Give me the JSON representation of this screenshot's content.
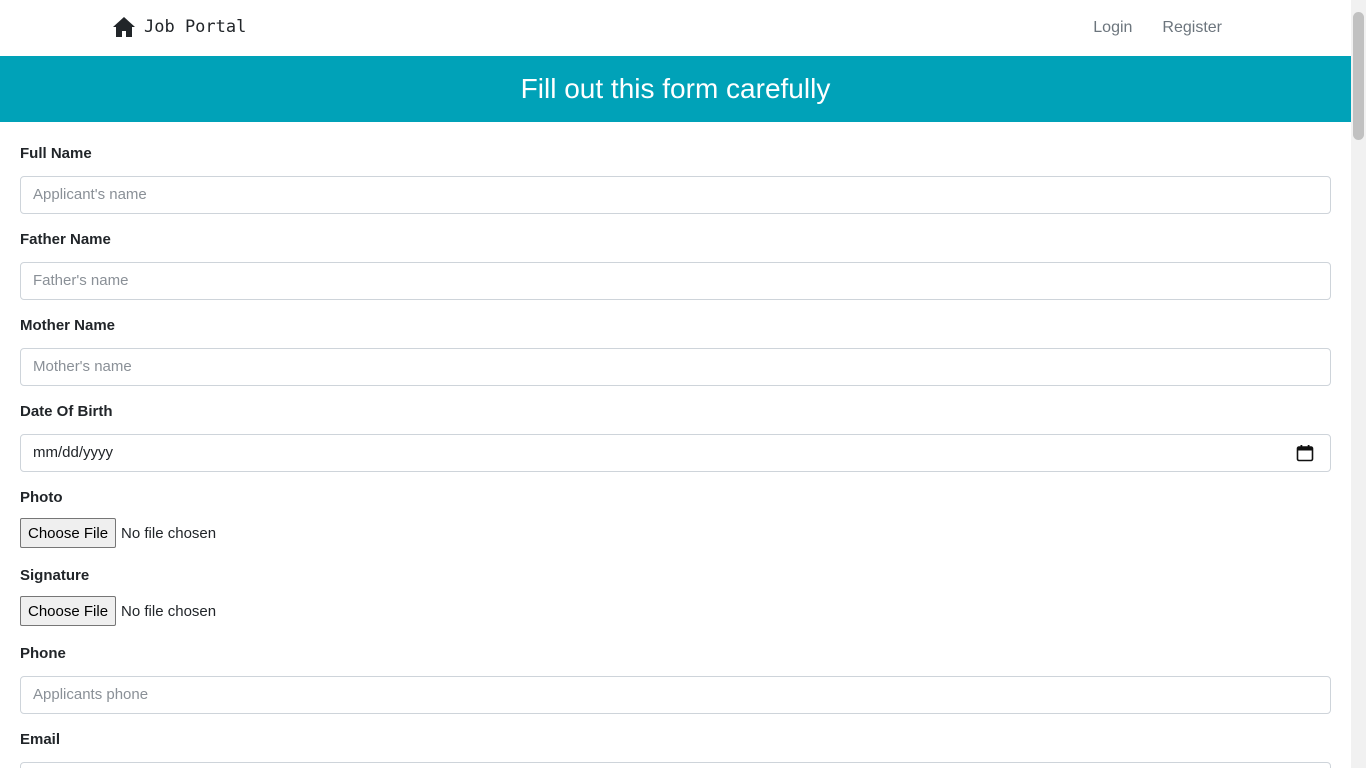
{
  "navbar": {
    "brand": "Job Portal",
    "brand_icon": "home-icon",
    "links": [
      "Login",
      "Register"
    ]
  },
  "banner": {
    "title": "Fill out this form carefully"
  },
  "form": {
    "full_name": {
      "label": "Full Name",
      "placeholder": "Applicant's name"
    },
    "father_name": {
      "label": "Father Name",
      "placeholder": "Father's name"
    },
    "mother_name": {
      "label": "Mother Name",
      "placeholder": "Mother's name"
    },
    "dob": {
      "label": "Date Of Birth",
      "value": "mm/dd/yyyy",
      "icon": "calendar-icon"
    },
    "photo": {
      "label": "Photo",
      "button": "Choose File",
      "status": "No file chosen"
    },
    "signature": {
      "label": "Signature",
      "button": "Choose File",
      "status": "No file chosen"
    },
    "phone": {
      "label": "Phone",
      "placeholder": "Applicants phone"
    },
    "email": {
      "label": "Email"
    }
  },
  "colors": {
    "banner": "#00a2b8",
    "nav_link": "#6c757d"
  }
}
